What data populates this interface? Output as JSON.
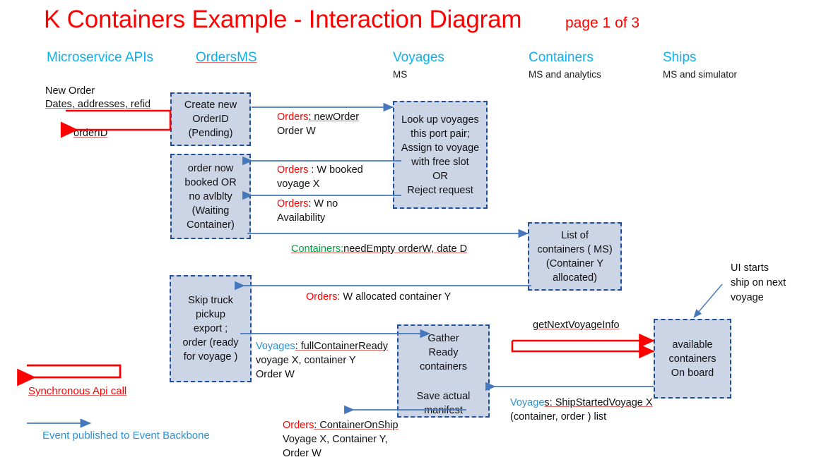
{
  "title": "K Containers Example - Interaction Diagram",
  "page_indicator": "page 1 of 3",
  "colors": {
    "title_red": "#ff0000",
    "header_cyan": "#0cb0f0",
    "box_fill": "#ccd5e5",
    "box_border": "#1f4e9c",
    "sync_arrow": "#ff0000",
    "event_arrow": "#4477bb",
    "green_topic": "#00a040",
    "blue_topic": "#2e90d0"
  },
  "columns": [
    {
      "name": "Microservice APIs",
      "subtitle": ""
    },
    {
      "name": "OrdersMS",
      "subtitle": ""
    },
    {
      "name": "Voyages",
      "subtitle": "MS"
    },
    {
      "name": "Containers",
      "subtitle": "MS and analytics"
    },
    {
      "name": "Ships",
      "subtitle": "MS and simulator"
    }
  ],
  "boxes": {
    "create_order": "Create new\nOrderID\n(Pending)",
    "order_booked": "order now\nbooked OR\nno avlblty\n(Waiting\nContainer)",
    "voyages_lookup": "Look up voyages\nthis port pair;\nAssign to voyage\nwith free slot\nOR\nReject request",
    "container_list": "List of\ncontainers ( MS)\n(Container Y\nallocated)",
    "skip_truck": "Skip truck\npickup\nexport ;\norder (ready\nfor voyage )",
    "gather_ready": "Gather\nReady\ncontainers",
    "save_manifest": "Save actual\nmanifest",
    "ship_available": "available\ncontainers\nOn board"
  },
  "labels": {
    "new_order_line1": "New Order",
    "new_order_line2": "Dates, addresses, refid",
    "order_id_return": "orderID",
    "orders_new_order_topic": "Orders",
    "orders_new_order_rest": ": newOrder",
    "orders_new_order_line2": "Order W",
    "orders_booked_topic": "Orders",
    "orders_booked_rest": " : W booked",
    "orders_booked_line2": "voyage X",
    "orders_noavail_topic": "Orders",
    "orders_noavail_rest": ":  W no",
    "orders_noavail_line2": "Availability",
    "containers_needempty_topic": "Containers:",
    "containers_needempty_rest": "needEmpty orderW, date D",
    "orders_allocated_topic": "Orders:",
    "orders_allocated_rest": "  W allocated  container Y",
    "voyages_fullready_topic": "Voyages",
    "voyages_fullready_rest": ":  fullContainerReady",
    "voyages_fullready_line2": "voyage X, container Y",
    "voyages_fullready_line3": "Order W",
    "get_next_voyage_info": "getNextVoyageInfo",
    "voyages_shipstarted_topic": "Voyage",
    "voyages_shipstarted_rest": "s: ShipStartedVoyage X",
    "voyages_shipstarted_line2": "(container, order ) list",
    "orders_containeronship_topic": "Orders",
    "orders_containeronship_rest": ": ContainerOnShip",
    "orders_containeronship_line2": "Voyage X,  Container Y,",
    "orders_containeronship_line3": " Order W",
    "ui_starts_line1": "UI starts",
    "ui_starts_line2": "ship on next",
    "ui_starts_line3": "voyage"
  },
  "legend": {
    "sync_api_call": "Synchronous Api call",
    "event_published": "Event published to Event Backbone"
  }
}
